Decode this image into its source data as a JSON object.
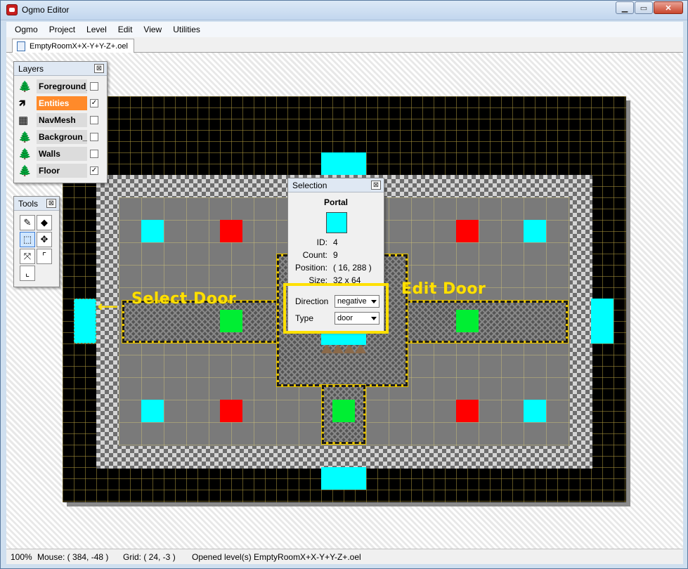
{
  "window": {
    "title": "Ogmo Editor"
  },
  "menu": [
    "Ogmo",
    "Project",
    "Level",
    "Edit",
    "View",
    "Utilities"
  ],
  "document_tab": "EmptyRoomX+X-Y+Y-Z+.oel",
  "layers_panel": {
    "title": "Layers",
    "close": "⊠",
    "layers": [
      {
        "name": "Foreground_",
        "icon": "tree-tile-icon",
        "checked": false,
        "active": false
      },
      {
        "name": "Entities",
        "icon": "entity-cursor-icon",
        "checked": true,
        "active": true
      },
      {
        "name": "NavMesh",
        "icon": "grid-icon",
        "checked": false,
        "active": false
      },
      {
        "name": "Backgroun_",
        "icon": "tree-tile-icon",
        "checked": false,
        "active": false
      },
      {
        "name": "Walls",
        "icon": "tree-tile-icon",
        "checked": false,
        "active": false
      },
      {
        "name": "Floor",
        "icon": "tree-tile-icon",
        "checked": true,
        "active": false
      }
    ],
    "check_mark": "✓"
  },
  "tools_panel": {
    "title": "Tools",
    "close": "⊠",
    "tools": [
      {
        "name": "pencil-tool",
        "glyph": "✎"
      },
      {
        "name": "fill-tool",
        "glyph": "◆"
      },
      {
        "name": "select-tool",
        "glyph": "⬚"
      },
      {
        "name": "move-tool",
        "glyph": "✥"
      },
      {
        "name": "resize-tool",
        "glyph": "⤧"
      },
      {
        "name": "rotate-tool",
        "glyph": "⌜"
      },
      {
        "name": "node-tool",
        "glyph": "⌞"
      }
    ]
  },
  "selection_panel": {
    "title": "Selection",
    "close": "⊠",
    "entity_name": "Portal",
    "swatch_color": "#00ffff",
    "fields": [
      {
        "label": "ID:",
        "value": "4"
      },
      {
        "label": "Count:",
        "value": "9"
      },
      {
        "label": "Position:",
        "value": "( 16, 288 )"
      },
      {
        "label": "Size:",
        "value": "32 x 64"
      }
    ],
    "direction_label": "Direction",
    "direction_value": "negative",
    "type_label": "Type",
    "type_value": "door"
  },
  "annotations": {
    "select_door": "Select Door",
    "edit_door": "Edit Door",
    "arrow": "⟵"
  },
  "status": {
    "zoom": "100%",
    "mouse": "Mouse: ( 384, -48 )",
    "grid": "Grid: ( 24, -3 )",
    "message": "Opened level(s) EmptyRoomX+X-Y+Y-Z+.oel"
  },
  "colors": {
    "accent_orange": "#ff8a2a",
    "annotation_yellow": "#ffe000",
    "portal_cyan": "#00ffff",
    "marker_red": "#ff0000",
    "marker_green": "#00ee33"
  }
}
